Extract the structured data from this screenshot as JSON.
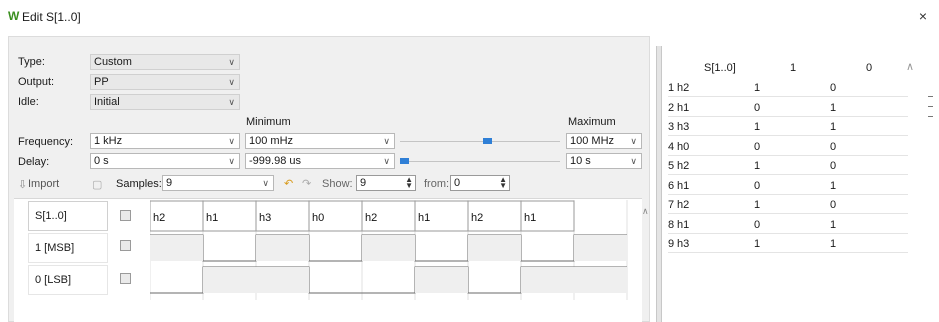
{
  "window": {
    "title": "Edit S[1..0]",
    "close": "×"
  },
  "form": {
    "type_label": "Type:",
    "type_value": "Custom",
    "output_label": "Output:",
    "output_value": "PP",
    "idle_label": "Idle:",
    "idle_value": "Initial",
    "minimum_label": "Minimum",
    "maximum_label": "Maximum",
    "frequency_label": "Frequency:",
    "frequency_value": "1 kHz",
    "frequency_min": "100 mHz",
    "frequency_max": "100 MHz",
    "delay_label": "Delay:",
    "delay_value": "0 s",
    "delay_min": "-999.98 us",
    "delay_max": "10 s"
  },
  "sliders": {
    "frequency_level": 0.52,
    "delay_level": 0.0,
    "accent": "#2f7fd6"
  },
  "toolbar": {
    "import_label": "Import",
    "samples_label": "Samples:",
    "samples_value": "9",
    "show_label": "Show:",
    "show_value": "9",
    "from_label": "from:",
    "from_value": "0"
  },
  "waveform": {
    "signals": [
      {
        "name": "S[1..0]"
      },
      {
        "name": "1 [MSB]"
      },
      {
        "name": "0 [LSB]"
      }
    ],
    "bus_labels": [
      "h2",
      "h1",
      "h3",
      "h0",
      "h2",
      "h1",
      "h2",
      "h1"
    ],
    "msb": [
      1,
      0,
      1,
      0,
      1,
      0,
      1,
      0,
      1
    ],
    "lsb": [
      0,
      1,
      1,
      0,
      0,
      1,
      0,
      1,
      1
    ]
  },
  "table": {
    "headers": [
      "S[1..0]",
      "1",
      "0"
    ],
    "rows": [
      {
        "n": "1",
        "s": "h2",
        "b1": "1",
        "b0": "0"
      },
      {
        "n": "2",
        "s": "h1",
        "b1": "0",
        "b0": "1"
      },
      {
        "n": "3",
        "s": "h3",
        "b1": "1",
        "b0": "1"
      },
      {
        "n": "4",
        "s": "h0",
        "b1": "0",
        "b0": "0"
      },
      {
        "n": "5",
        "s": "h2",
        "b1": "1",
        "b0": "0"
      },
      {
        "n": "6",
        "s": "h1",
        "b1": "0",
        "b0": "1"
      },
      {
        "n": "7",
        "s": "h2",
        "b1": "1",
        "b0": "0"
      },
      {
        "n": "8",
        "s": "h1",
        "b1": "0",
        "b0": "1"
      },
      {
        "n": "9",
        "s": "h3",
        "b1": "1",
        "b0": "1"
      }
    ]
  }
}
